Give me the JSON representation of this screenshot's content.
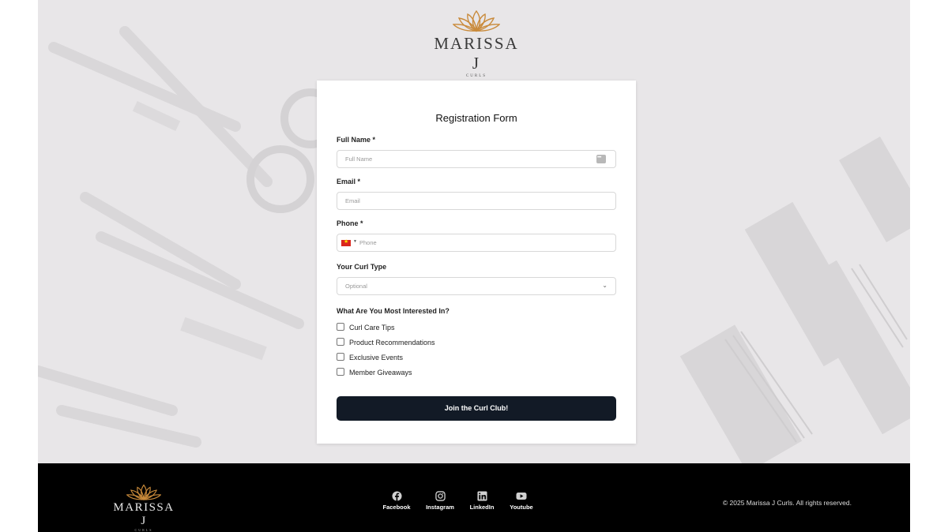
{
  "brand": {
    "name": "MARISSA J",
    "sub": "CURLS"
  },
  "form": {
    "title": "Registration Form",
    "full_name": {
      "label": "Full Name *",
      "placeholder": "Full Name"
    },
    "email": {
      "label": "Email *",
      "placeholder": "Email"
    },
    "phone": {
      "label": "Phone *",
      "placeholder": "Phone",
      "country": "Vietnam"
    },
    "curl_type": {
      "label": "Your Curl Type",
      "placeholder": "Optional"
    },
    "interests": {
      "label": "What Are You Most Interested In?",
      "options": [
        "Curl Care Tips",
        "Product Recommendations",
        "Exclusive Events",
        "Member Giveaways"
      ]
    },
    "submit_label": "Join the Curl Club!"
  },
  "footer": {
    "social": [
      {
        "label": "Facebook",
        "icon": "facebook-icon"
      },
      {
        "label": "Instagram",
        "icon": "instagram-icon"
      },
      {
        "label": "LinkedIn",
        "icon": "linkedin-icon"
      },
      {
        "label": "Youtube",
        "icon": "youtube-icon"
      }
    ],
    "copyright": "© 2025 Marissa J Curls. All rights reserved."
  },
  "colors": {
    "accent": "#c98a3a",
    "button": "#121a26",
    "background": "#e8e6e8",
    "footer": "#000000"
  }
}
